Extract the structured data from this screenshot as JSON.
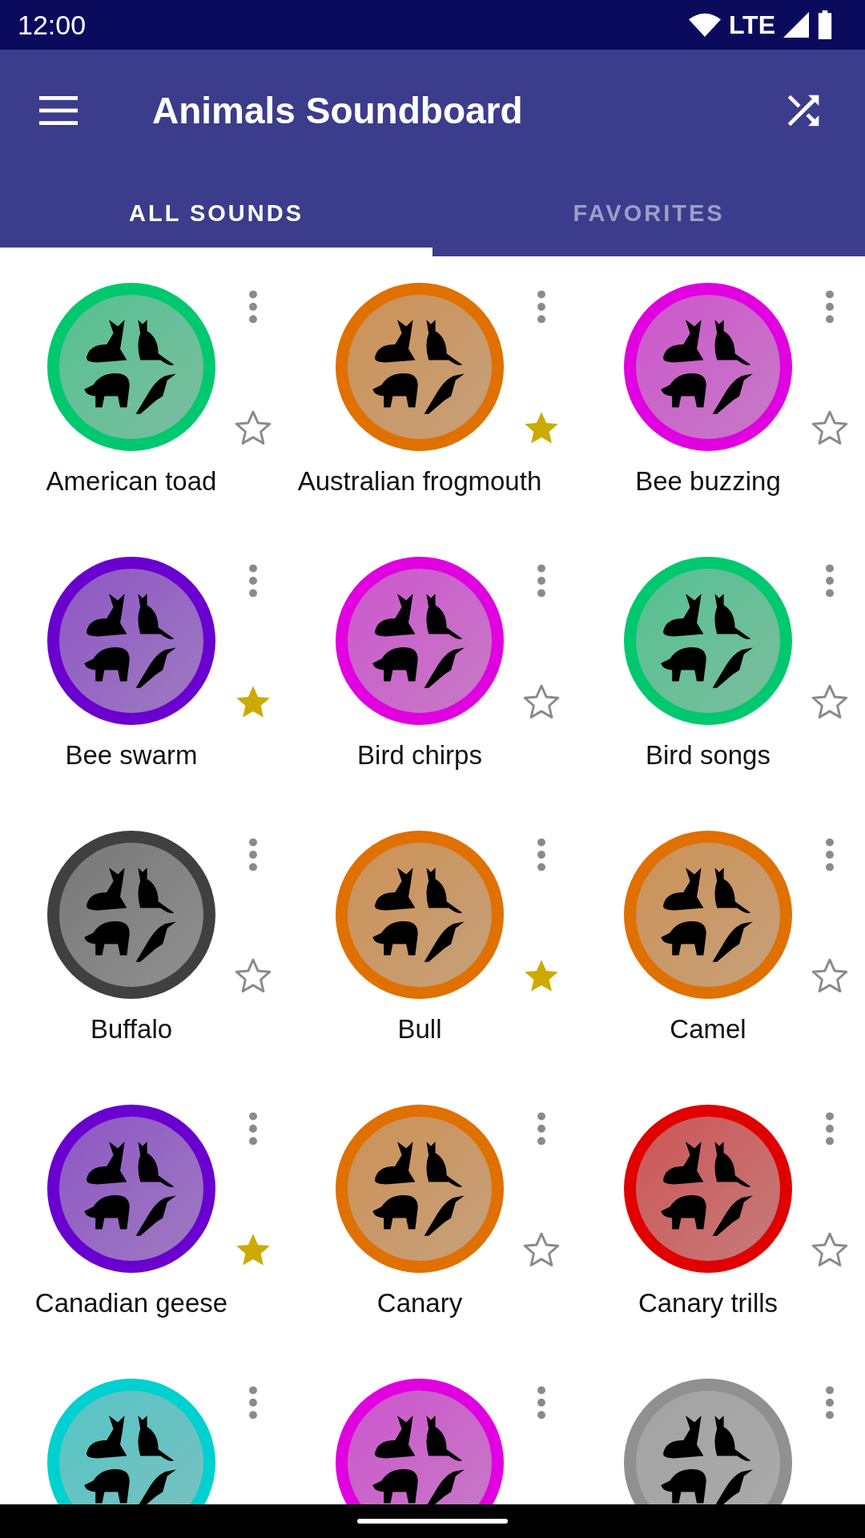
{
  "status_bar": {
    "time": "12:00",
    "network": "LTE"
  },
  "app_bar": {
    "title": "Animals Soundboard"
  },
  "tabs": [
    {
      "label": "ALL SOUNDS",
      "selected": true
    },
    {
      "label": "FAVORITES",
      "selected": false
    }
  ],
  "sounds": [
    {
      "label": "American toad",
      "favorite": false,
      "color": "#00c86e"
    },
    {
      "label": "Australian frogmouth",
      "favorite": true,
      "color": "#e07000"
    },
    {
      "label": "Bee buzzing",
      "favorite": false,
      "color": "#e000e0"
    },
    {
      "label": "Bee swarm",
      "favorite": true,
      "color": "#6a00d0"
    },
    {
      "label": "Bird chirps",
      "favorite": false,
      "color": "#e000e0"
    },
    {
      "label": "Bird songs",
      "favorite": false,
      "color": "#00c86e"
    },
    {
      "label": "Buffalo",
      "favorite": false,
      "color": "#404040"
    },
    {
      "label": "Bull",
      "favorite": true,
      "color": "#e07000"
    },
    {
      "label": "Camel",
      "favorite": false,
      "color": "#e07000"
    },
    {
      "label": "Canadian geese",
      "favorite": true,
      "color": "#6a00d0"
    },
    {
      "label": "Canary",
      "favorite": false,
      "color": "#e07000"
    },
    {
      "label": "Canary trills",
      "favorite": false,
      "color": "#e00000"
    },
    {
      "color": "#00d0d0"
    },
    {
      "color": "#e000e0"
    },
    {
      "color": "#909090"
    }
  ]
}
